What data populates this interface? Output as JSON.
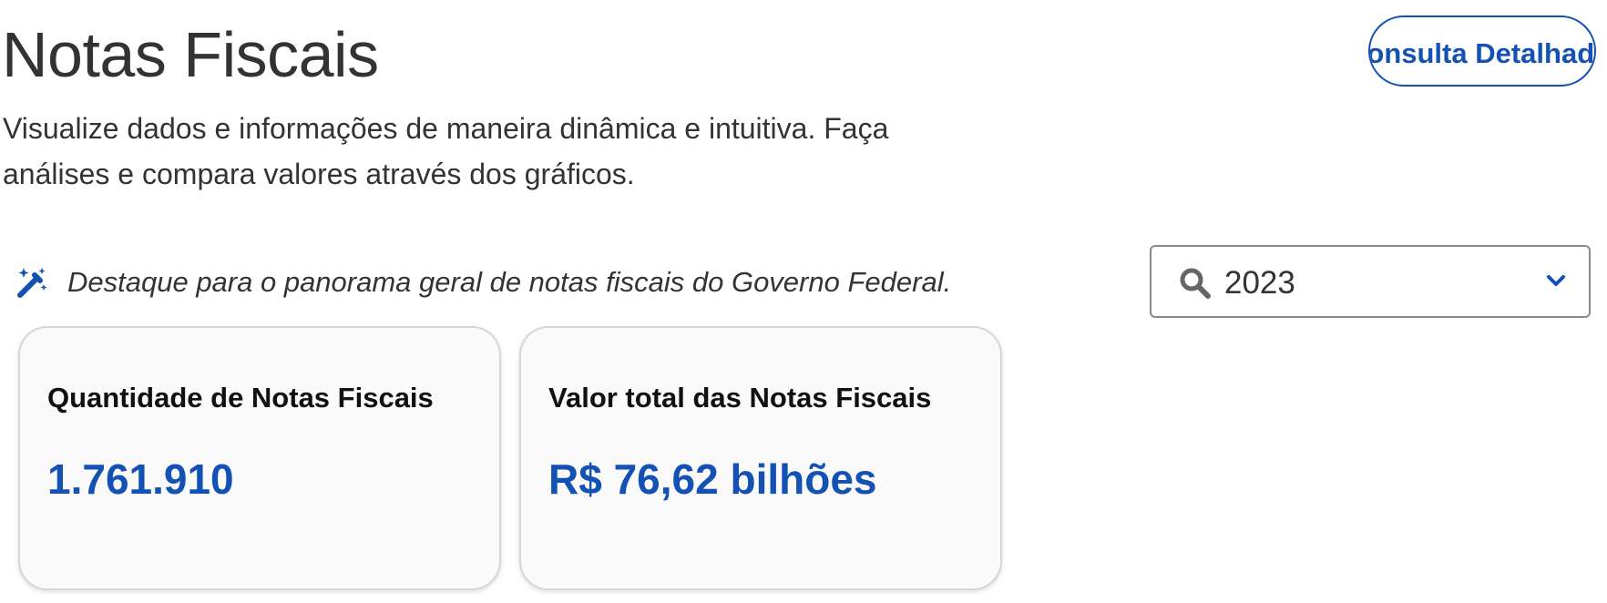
{
  "header": {
    "title": "Notas Fiscais",
    "subtitle": "Visualize dados e informações de maneira dinâmica e intuitiva. Faça análises e compara valores através dos gráficos.",
    "detail_button_label": "Consulta Detalhada"
  },
  "highlight": {
    "icon": "magic-wand-icon",
    "text": "Destaque para o panorama geral de notas fiscais do Governo Federal."
  },
  "year_filter": {
    "icon": "search-icon",
    "selected_value": "2023",
    "dropdown_icon": "chevron-down-icon"
  },
  "cards": [
    {
      "title": "Quantidade de Notas Fiscais",
      "value": "1.761.910"
    },
    {
      "title": "Valor total das Notas Fiscais",
      "value": "R$ 76,62 bilhões"
    }
  ],
  "colors": {
    "accent": "#1351b4",
    "text": "#333333",
    "card_background": "#fafafa",
    "card_border": "#d6d6d6"
  }
}
